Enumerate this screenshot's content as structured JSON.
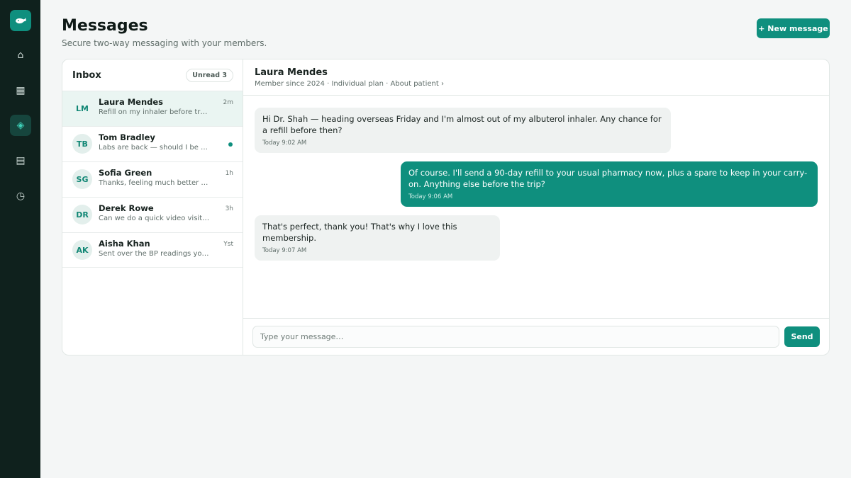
{
  "nav": {
    "logo_icon": "whale-icon",
    "items": [
      {
        "icon": "home-icon",
        "glyph": "⌂",
        "active": false
      },
      {
        "icon": "calendar-icon",
        "glyph": "▦",
        "active": false
      },
      {
        "icon": "messages-icon",
        "glyph": "◈",
        "active": true
      },
      {
        "icon": "records-icon",
        "glyph": "▤",
        "active": false
      },
      {
        "icon": "history-icon",
        "glyph": "◷",
        "active": false
      }
    ]
  },
  "header": {
    "title": "Messages",
    "subtitle": "Secure two-way messaging with your members.",
    "new_message_label": "+ New message"
  },
  "inbox": {
    "title": "Inbox",
    "unread_label": "Unread 3",
    "conversations": [
      {
        "initials": "LM",
        "name": "Laura Mendes",
        "preview": "Refill on my inhaler before travel?",
        "time": "2m",
        "active": true,
        "unread": false
      },
      {
        "initials": "TB",
        "name": "Tom Bradley",
        "preview": "Labs are back — should I be worried?",
        "time": "",
        "active": false,
        "unread": true
      },
      {
        "initials": "SG",
        "name": "Sofia Green",
        "preview": "Thanks, feeling much better today!",
        "time": "1h",
        "active": false,
        "unread": false
      },
      {
        "initials": "DR",
        "name": "Derek Rowe",
        "preview": "Can we do a quick video visit today?",
        "time": "3h",
        "active": false,
        "unread": false
      },
      {
        "initials": "AK",
        "name": "Aisha Khan",
        "preview": "Sent over the BP readings you asked for",
        "time": "Yst",
        "active": false,
        "unread": false
      }
    ]
  },
  "thread": {
    "name": "Laura Mendes",
    "meta": "Member since 2024 · Individual plan · About patient ›",
    "messages": [
      {
        "direction": "in",
        "text": "Hi Dr. Shah — heading overseas Friday and I'm almost out of my albuterol inhaler. Any chance for a refill before then?",
        "time": "Today 9:02 AM"
      },
      {
        "direction": "out",
        "text": "Of course. I'll send a 90-day refill to your usual pharmacy now, plus a spare to keep in your carry-on. Anything else before the trip?",
        "time": "Today 9:06 AM"
      },
      {
        "direction": "in",
        "text": "That's perfect, thank you! That's why I love this membership.",
        "time": "Today 9:07 AM"
      }
    ]
  },
  "composer": {
    "placeholder": "Type your message…",
    "send_label": "Send"
  },
  "colors": {
    "accent": "#0f8f7e",
    "sidebar": "#0f211d",
    "background": "#f4f6f6"
  }
}
